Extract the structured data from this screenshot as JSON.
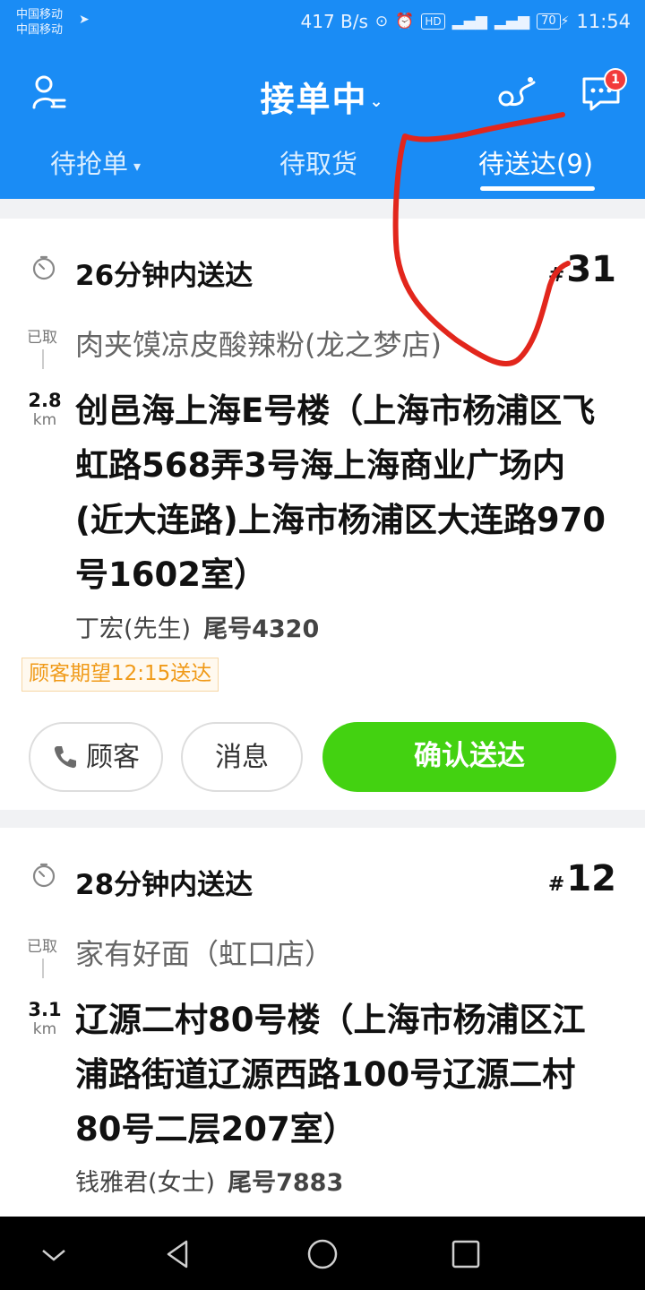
{
  "status_bar": {
    "carrier_1": "中国移动",
    "carrier_2": "中国移动",
    "net_speed": "417 B/s",
    "hd_label": "HD",
    "battery": "70",
    "time": "11:54"
  },
  "header": {
    "title": "接单中",
    "message_badge": "1",
    "accent_color": "#1a8cf5"
  },
  "tabs": [
    {
      "label": "待抢单"
    },
    {
      "label": "待取货"
    },
    {
      "label": "待送达(9)",
      "active": true
    }
  ],
  "orders": [
    {
      "eta": "26分钟内送达",
      "number_prefix": "#",
      "number": "31",
      "picked_label": "已取",
      "shop": "肉夹馍凉皮酸辣粉(龙之梦店)",
      "distance": "2.8",
      "distance_unit": "km",
      "address": "创邑海上海E号楼（上海市杨浦区飞虹路568弄3号海上海商业广场内(近大连路)上海市杨浦区大连路970号1602室）",
      "customer_name": "丁宏(先生)",
      "phone_tail": "尾号4320",
      "expected": "顾客期望12:15送达",
      "btn_customer": "顾客",
      "btn_message": "消息",
      "btn_confirm": "确认送达"
    },
    {
      "eta": "28分钟内送达",
      "number_prefix": "#",
      "number": "12",
      "picked_label": "已取",
      "shop": "家有好面（虹口店）",
      "distance": "3.1",
      "distance_unit": "km",
      "address": "辽源二村80号楼（上海市杨浦区江浦路街道辽源西路100号辽源二村80号二层207室）",
      "customer_name": "钱雅君(女士)",
      "phone_tail": "尾号7883"
    }
  ],
  "colors": {
    "confirm_green": "#43d211",
    "expect_orange": "#f09a18",
    "annotation_red": "#e2261c"
  }
}
